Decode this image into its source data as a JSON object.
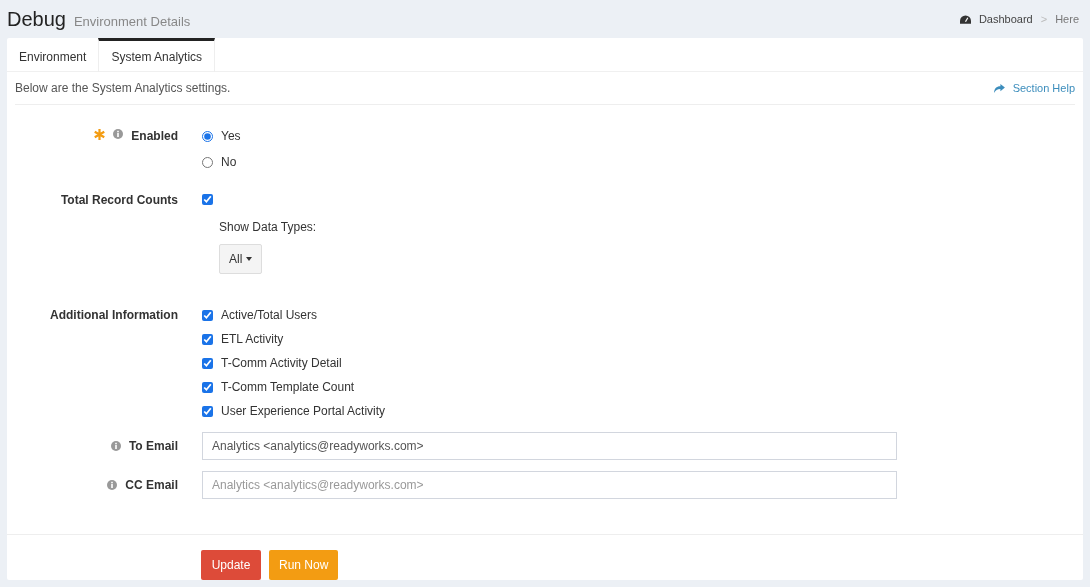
{
  "header": {
    "title": "Debug",
    "subtitle": "Environment Details",
    "breadcrumb": [
      {
        "label": "Dashboard",
        "kind": "link"
      },
      {
        "label": ">",
        "kind": "separator"
      },
      {
        "label": "Here",
        "kind": "current"
      }
    ]
  },
  "tabs": [
    {
      "label": "Environment",
      "selected": false
    },
    {
      "label": "System Analytics",
      "selected": true
    }
  ],
  "intro": "Below are the System Analytics settings.",
  "section_help": "Section Help",
  "enabled": {
    "label": "Enabled",
    "required": true,
    "info": true,
    "options": [
      {
        "label": "Yes",
        "selected": true
      },
      {
        "label": "No",
        "selected": false
      }
    ]
  },
  "total_record_counts": {
    "label": "Total Record Counts",
    "checked": true,
    "show_data_types_label": "Show Data Types:",
    "dropdown": "All"
  },
  "additional_information": {
    "label": "Additional Information",
    "items": [
      {
        "label": "Active/Total Users",
        "checked": true
      },
      {
        "label": "ETL Activity",
        "checked": true
      },
      {
        "label": "T-Comm Activity Detail",
        "checked": true
      },
      {
        "label": "T-Comm Template Count",
        "checked": true
      },
      {
        "label": "User Experience Portal Activity",
        "checked": true
      }
    ]
  },
  "emails": [
    {
      "label": "To Email",
      "value": "Analytics <analytics@readyworks.com>"
    },
    {
      "label": "CC Email",
      "placeholder": "Analytics <analytics@readyworks.com>"
    }
  ],
  "buttons": [
    {
      "label": "Update",
      "kind": "danger"
    },
    {
      "label": "Run Now",
      "kind": "warning"
    }
  ]
}
